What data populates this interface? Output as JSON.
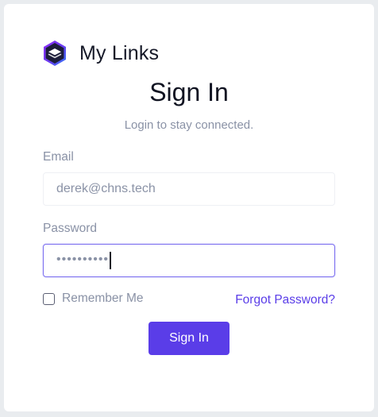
{
  "brand": {
    "logo_icon": "hexagon-layers-icon",
    "name": "My Links"
  },
  "form": {
    "title": "Sign In",
    "subtitle": "Login to stay connected.",
    "email": {
      "label": "Email",
      "value": "derek@chns.tech"
    },
    "password": {
      "label": "Password",
      "masked_value": "••••••••••"
    },
    "remember_me": {
      "label": "Remember Me",
      "checked": false
    },
    "forgot_password_label": "Forgot Password?",
    "submit_label": "Sign In"
  },
  "colors": {
    "accent": "#5a3de8",
    "focus_border": "#7c6ff0",
    "muted_text": "#8a92a6",
    "heading_text": "#111422",
    "page_background": "#e9ecef",
    "card_background": "#ffffff"
  }
}
